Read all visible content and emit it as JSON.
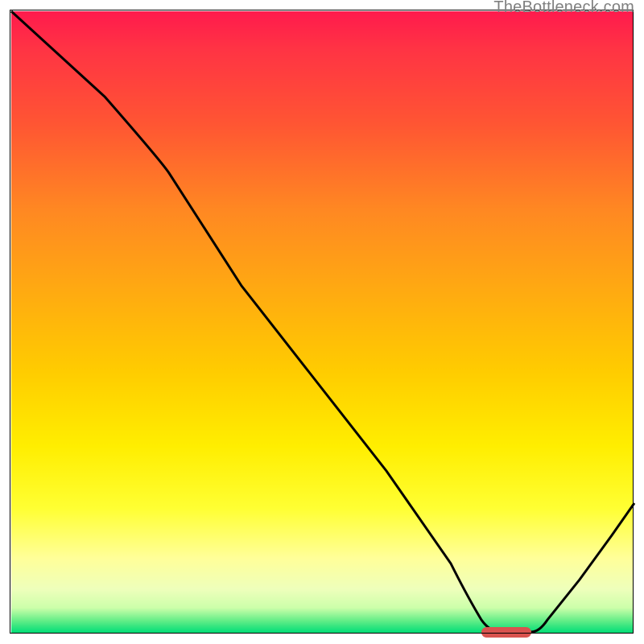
{
  "watermark": "TheBottleneck.com",
  "chart_data": {
    "type": "line",
    "title": "",
    "xlabel": "",
    "ylabel": "",
    "xlim": [
      0,
      100
    ],
    "ylim": [
      0,
      100
    ],
    "grid": false,
    "series": [
      {
        "name": "curve",
        "x": [
          1.8,
          15,
          25,
          35,
          45,
          55,
          65,
          72,
          76,
          80,
          85,
          90,
          95,
          100
        ],
        "y": [
          100,
          86,
          75,
          57,
          42,
          27,
          12,
          2,
          0,
          0,
          6,
          13,
          20,
          27
        ]
      }
    ],
    "marker": {
      "shape": "rounded-bar",
      "color": "#d9534f",
      "x_range": [
        75,
        83
      ],
      "y": 0.5
    },
    "background_gradient": {
      "top": "#ff1a4d",
      "middle": "#ffee00",
      "bottom": "#00dd77"
    }
  }
}
